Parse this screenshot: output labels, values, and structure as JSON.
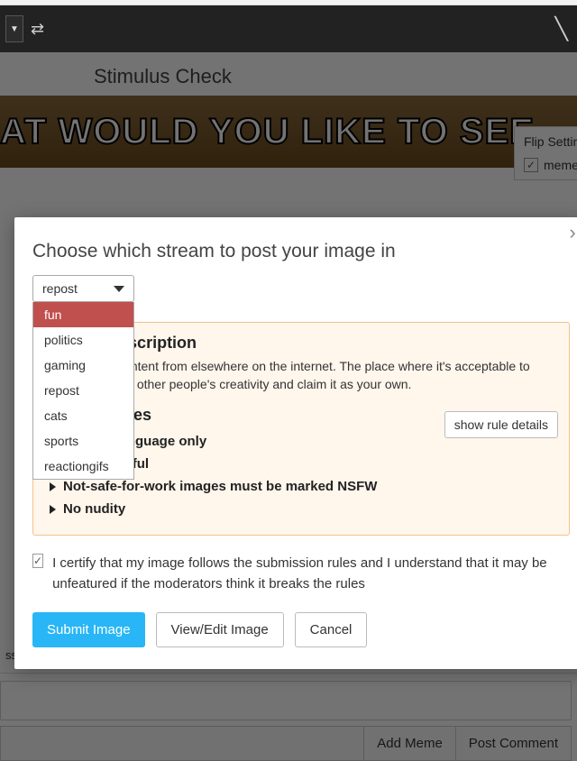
{
  "page_title": "Stimulus Check",
  "hero_text": "AT WOULD YOU LIKE TO SEE",
  "sidebar": {
    "title": "Flip Settings",
    "checkbox_label": "memes",
    "checked": true
  },
  "meta_time": "ss than an hour ago",
  "comment_actions": {
    "add_meme": "Add Meme",
    "post": "Post Comment"
  },
  "modal": {
    "title": "Choose which stream to post your image in",
    "select_value": "repost",
    "options": [
      "fun",
      "politics",
      "gaming",
      "repost",
      "cats",
      "sports",
      "reactiongifs"
    ],
    "highlighted_index": 0,
    "description_heading": "Stream Description",
    "description_text": "Memes and content from elsewhere on the internet. The place where it's acceptable to copy and paste other people's creativity and claim it as your own.",
    "rules_heading": "Stream Rules",
    "show_rule_details": "show rule details",
    "rules": [
      "English language only",
      "Be respectful",
      "Not-safe-for-work images must be marked NSFW",
      "No nudity"
    ],
    "certify_text": "I certify that my image follows the submission rules and I understand that it may be unfeatured if the moderators think it breaks the rules",
    "submit_label": "Submit Image",
    "view_edit_label": "View/Edit Image",
    "cancel_label": "Cancel"
  }
}
